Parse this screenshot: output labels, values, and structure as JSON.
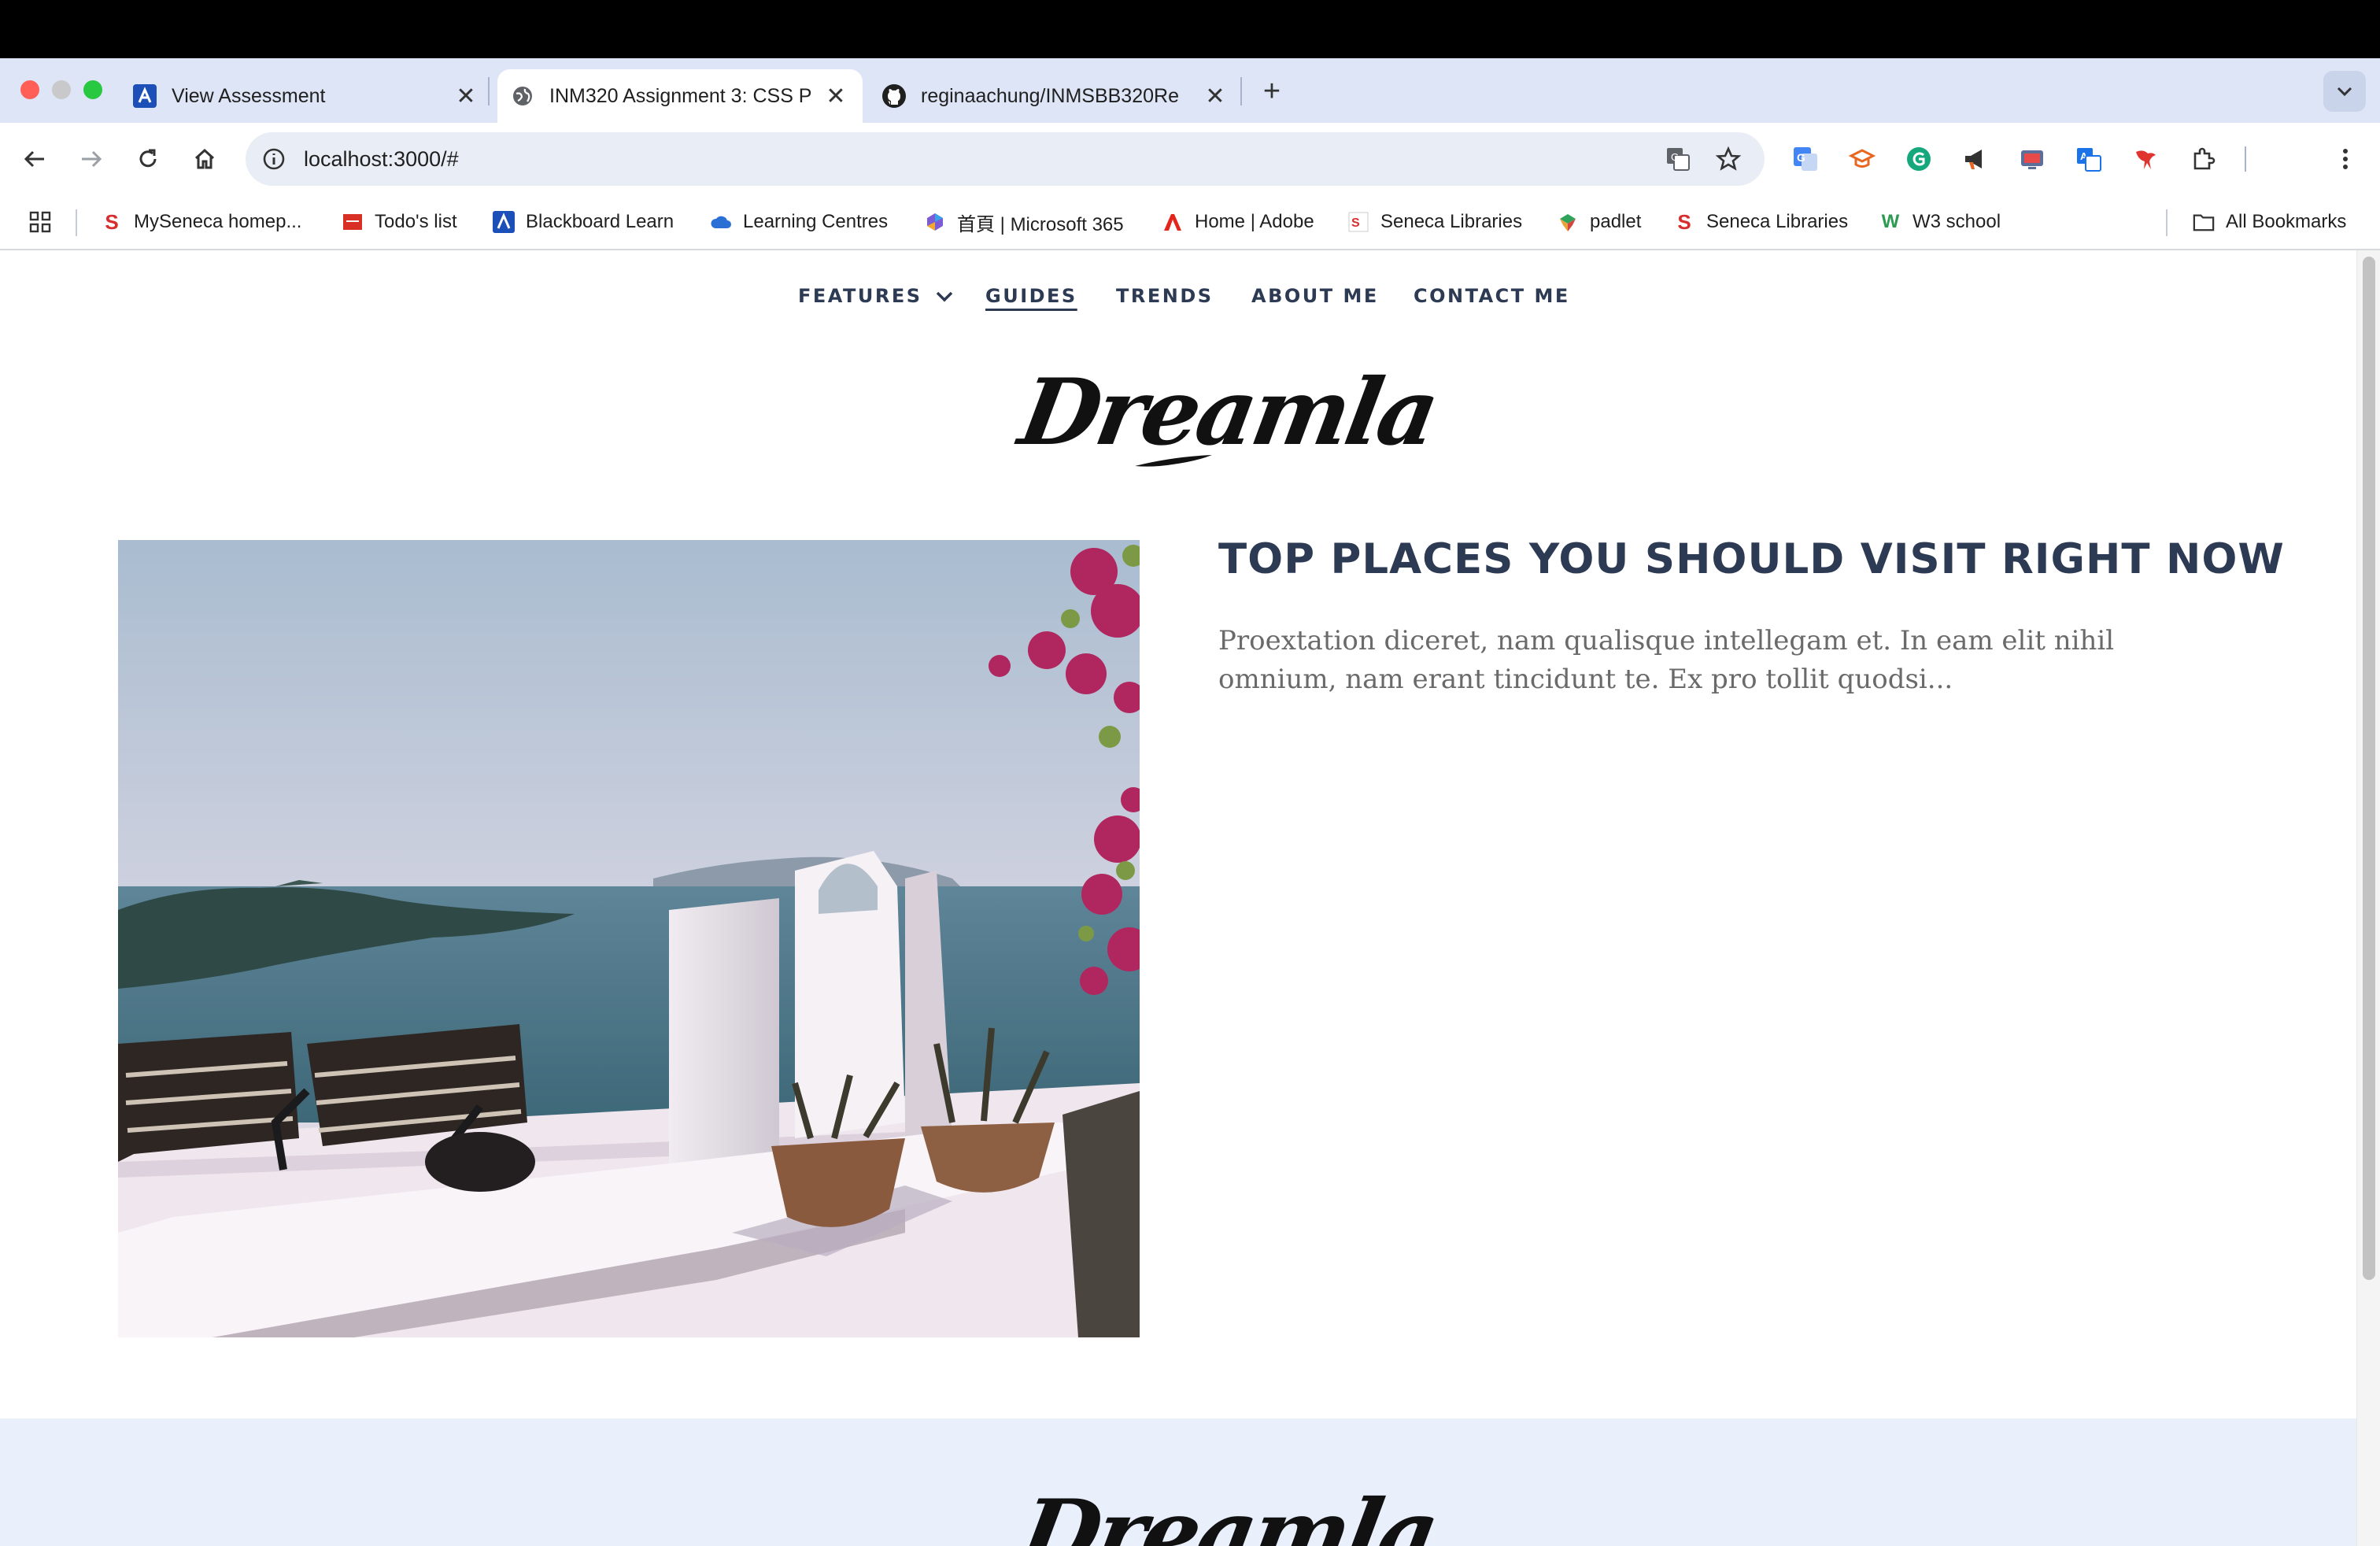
{
  "browser": {
    "tabs": [
      {
        "title": "View Assessment",
        "active": false
      },
      {
        "title": "INM320 Assignment 3: CSS P",
        "active": true
      },
      {
        "title": "reginaachung/INMSBB320Re",
        "active": false
      }
    ],
    "address": "localhost:3000/#",
    "bookmarks": [
      {
        "label": "MySeneca homep...",
        "icon": "seneca-icon"
      },
      {
        "label": "Todo's list",
        "icon": "todo-icon"
      },
      {
        "label": "Blackboard Learn",
        "icon": "blackboard-icon"
      },
      {
        "label": "Learning Centres",
        "icon": "cloud-icon"
      },
      {
        "label": "首頁 | Microsoft 365",
        "icon": "microsoft365-icon"
      },
      {
        "label": "Home | Adobe",
        "icon": "adobe-icon"
      },
      {
        "label": "Seneca Libraries",
        "icon": "seneca-lib-icon"
      },
      {
        "label": "padlet",
        "icon": "padlet-icon"
      },
      {
        "label": "Seneca Libraries",
        "icon": "seneca-icon"
      },
      {
        "label": "W3 school",
        "icon": "w3-icon"
      }
    ],
    "all_bookmarks": "All Bookmarks"
  },
  "site": {
    "nav": [
      "FEATURES",
      "GUIDES",
      "TRENDS",
      "ABOUT ME",
      "CONTACT ME"
    ],
    "active_nav": "GUIDES",
    "logo": "Dreamla",
    "post": {
      "title": "TOP PLACES YOU SHOULD VISIT RIGHT NOW",
      "excerpt": "Proextation diceret, nam qualisque intellegam et. In eam elit nihil omnium, nam erant tincidunt te. Ex pro tollit quodsi..."
    },
    "footer_logo": "Dreamla"
  },
  "colors": {
    "navy": "#2d3a53",
    "tabstrip": "#dde5f7",
    "footer_band": "#e9effb"
  }
}
